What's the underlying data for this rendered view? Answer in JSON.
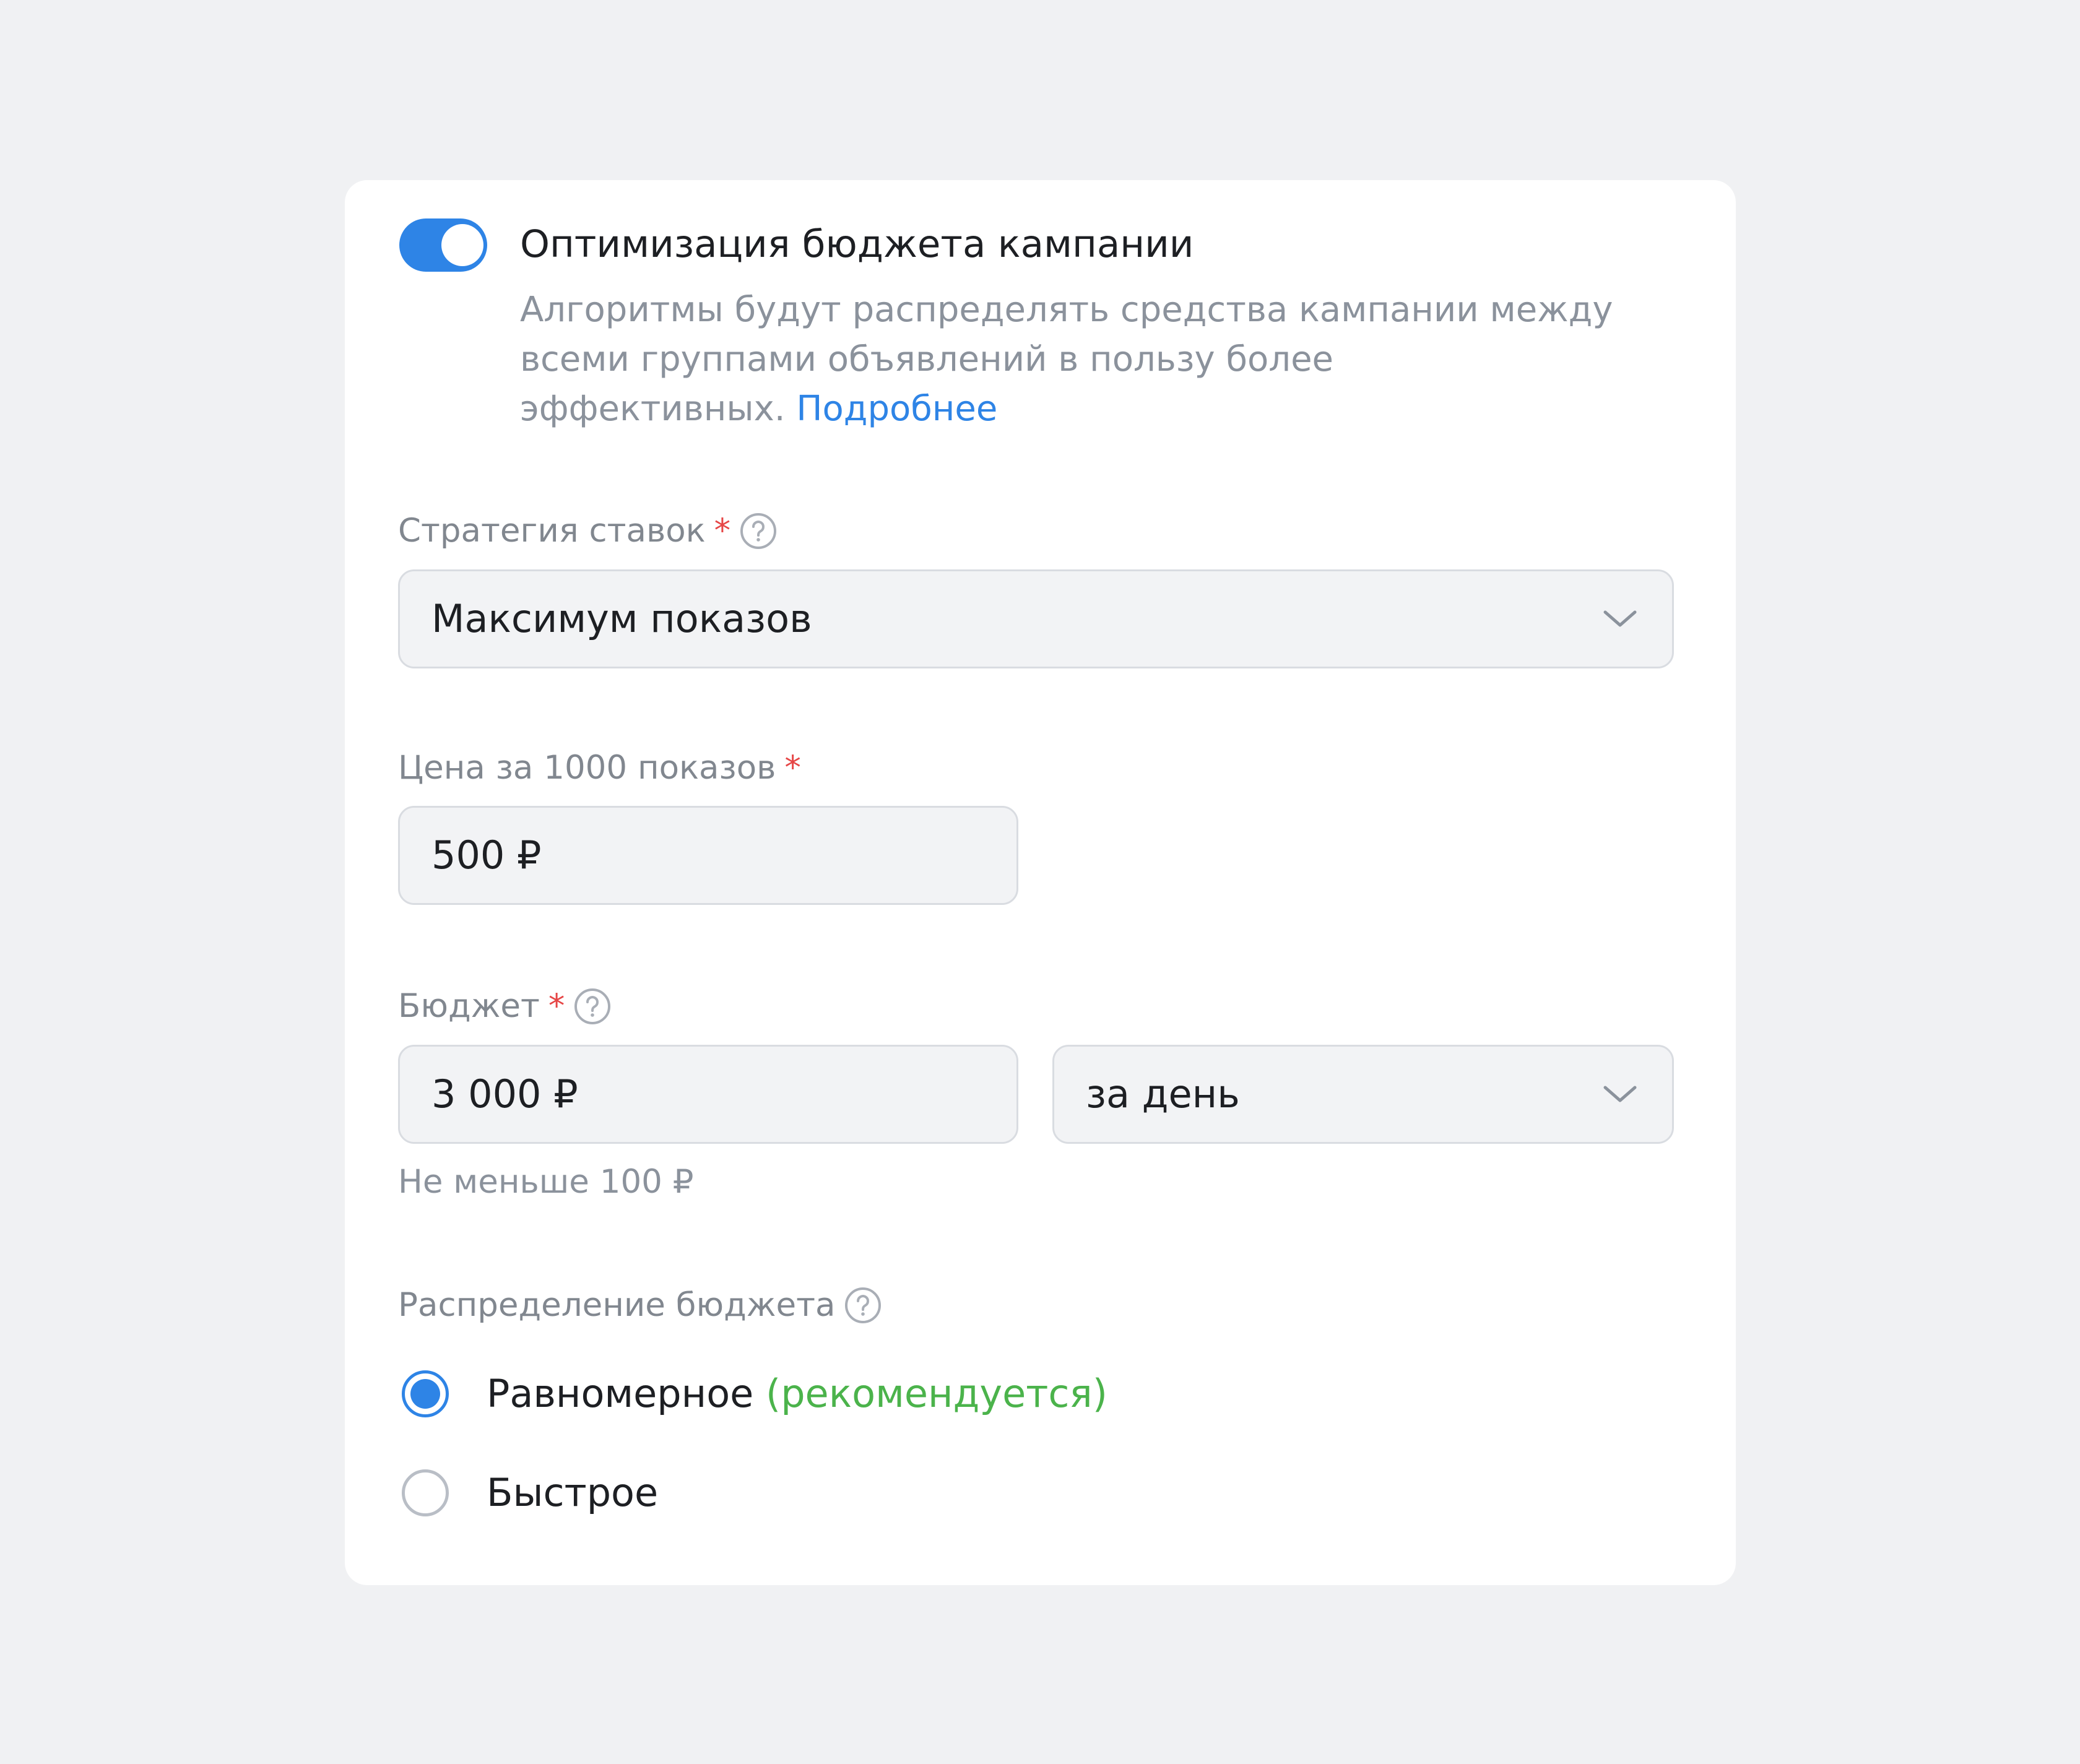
{
  "colors": {
    "accent": "#2e84e6",
    "required": "#e64646",
    "recommended": "#4bb34b",
    "page_background": "#f0f1f3",
    "card_background": "#ffffff"
  },
  "optimization": {
    "enabled": true,
    "title": "Оптимизация бюджета кампании",
    "description_lines": [
      "Алгоритмы будут распределять средства кампании между",
      "всеми группами объявлений в пользу более",
      "эффективных."
    ],
    "more_link": "Подробнее"
  },
  "bid_strategy": {
    "label": "Стратегия ставок",
    "required_mark": "*",
    "help_icon": "question-circle-icon",
    "value": "Максимум показов"
  },
  "cpm": {
    "label": "Цена за 1000 показов",
    "required_mark": "*",
    "value": "500 ₽"
  },
  "budget": {
    "label": "Бюджет",
    "required_mark": "*",
    "help_icon": "question-circle-icon",
    "amount": "3 000 ₽",
    "period": "за день",
    "hint": "Не меньше 100 ₽"
  },
  "distribution": {
    "label": "Распределение бюджета",
    "help_icon": "question-circle-icon",
    "options": [
      {
        "label": "Равномерное",
        "note": "(рекомендуется)",
        "selected": true
      },
      {
        "label": "Быстрое",
        "note": "",
        "selected": false
      }
    ]
  }
}
